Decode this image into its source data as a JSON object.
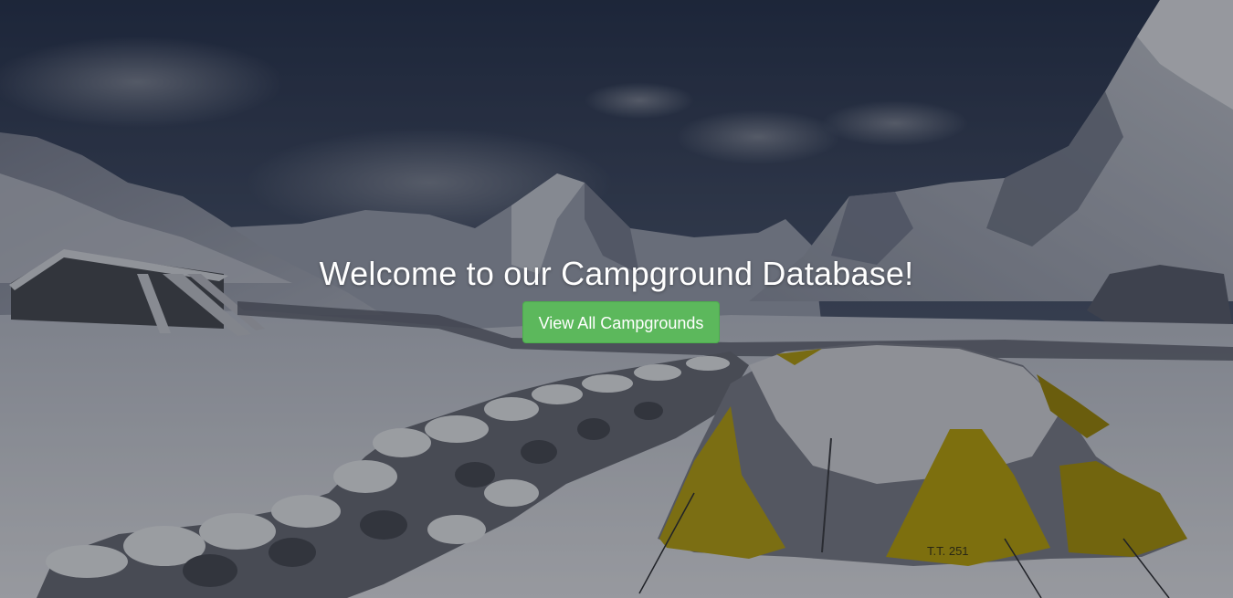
{
  "hero": {
    "heading": "Welcome to our Campground Database!",
    "button_label": "View All Campgrounds"
  },
  "background": {
    "tent_label": "T.T. 251"
  },
  "colors": {
    "button": "#5cb85c",
    "button_border": "#4cae4c",
    "heading_text": "#ffffff",
    "sky": "#2b3855"
  }
}
